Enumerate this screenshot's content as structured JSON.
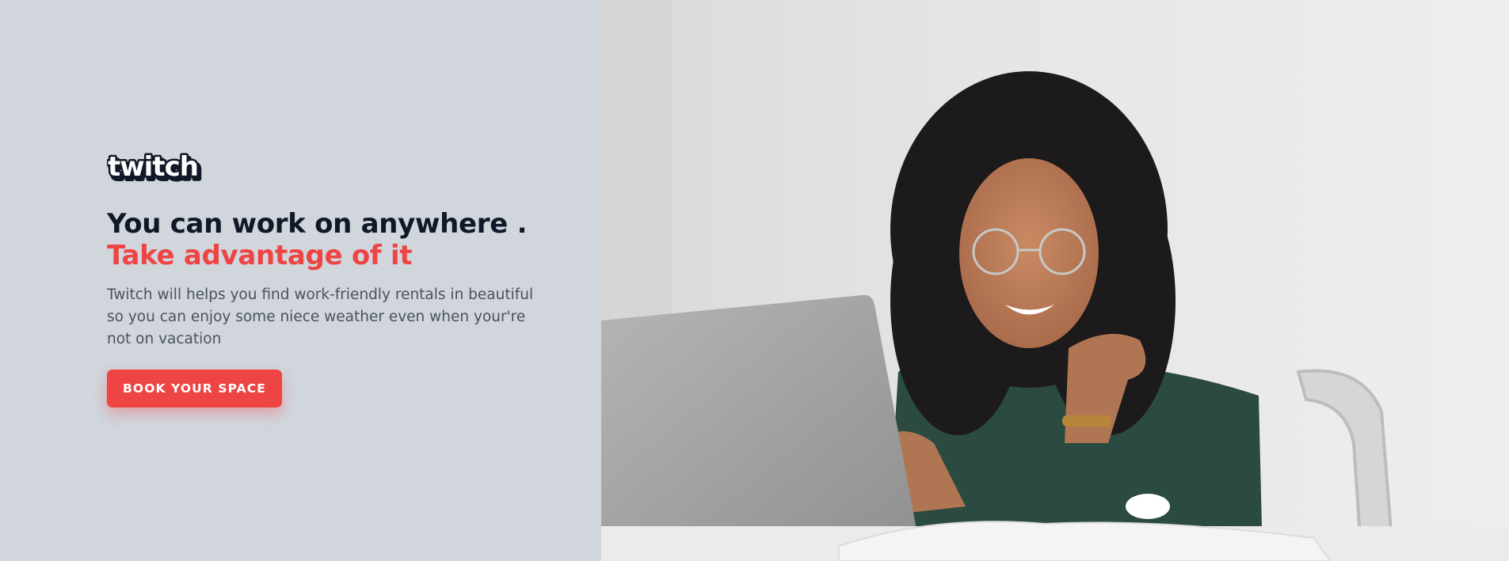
{
  "brand": {
    "logo_text": "twitch"
  },
  "hero": {
    "heading_line1": "You can work on anywhere .",
    "heading_line2": "Take advantage of it",
    "description": "Twitch will helps you find work-friendly rentals in beautiful so you can enjoy some niece weather even when your're not on vacation",
    "cta_label": "BOOK YOUR SPACE"
  },
  "colors": {
    "left_panel_bg": "#d1d5dc",
    "heading": "#101827",
    "accent": "#ef4444",
    "body_text": "#4a5260"
  }
}
